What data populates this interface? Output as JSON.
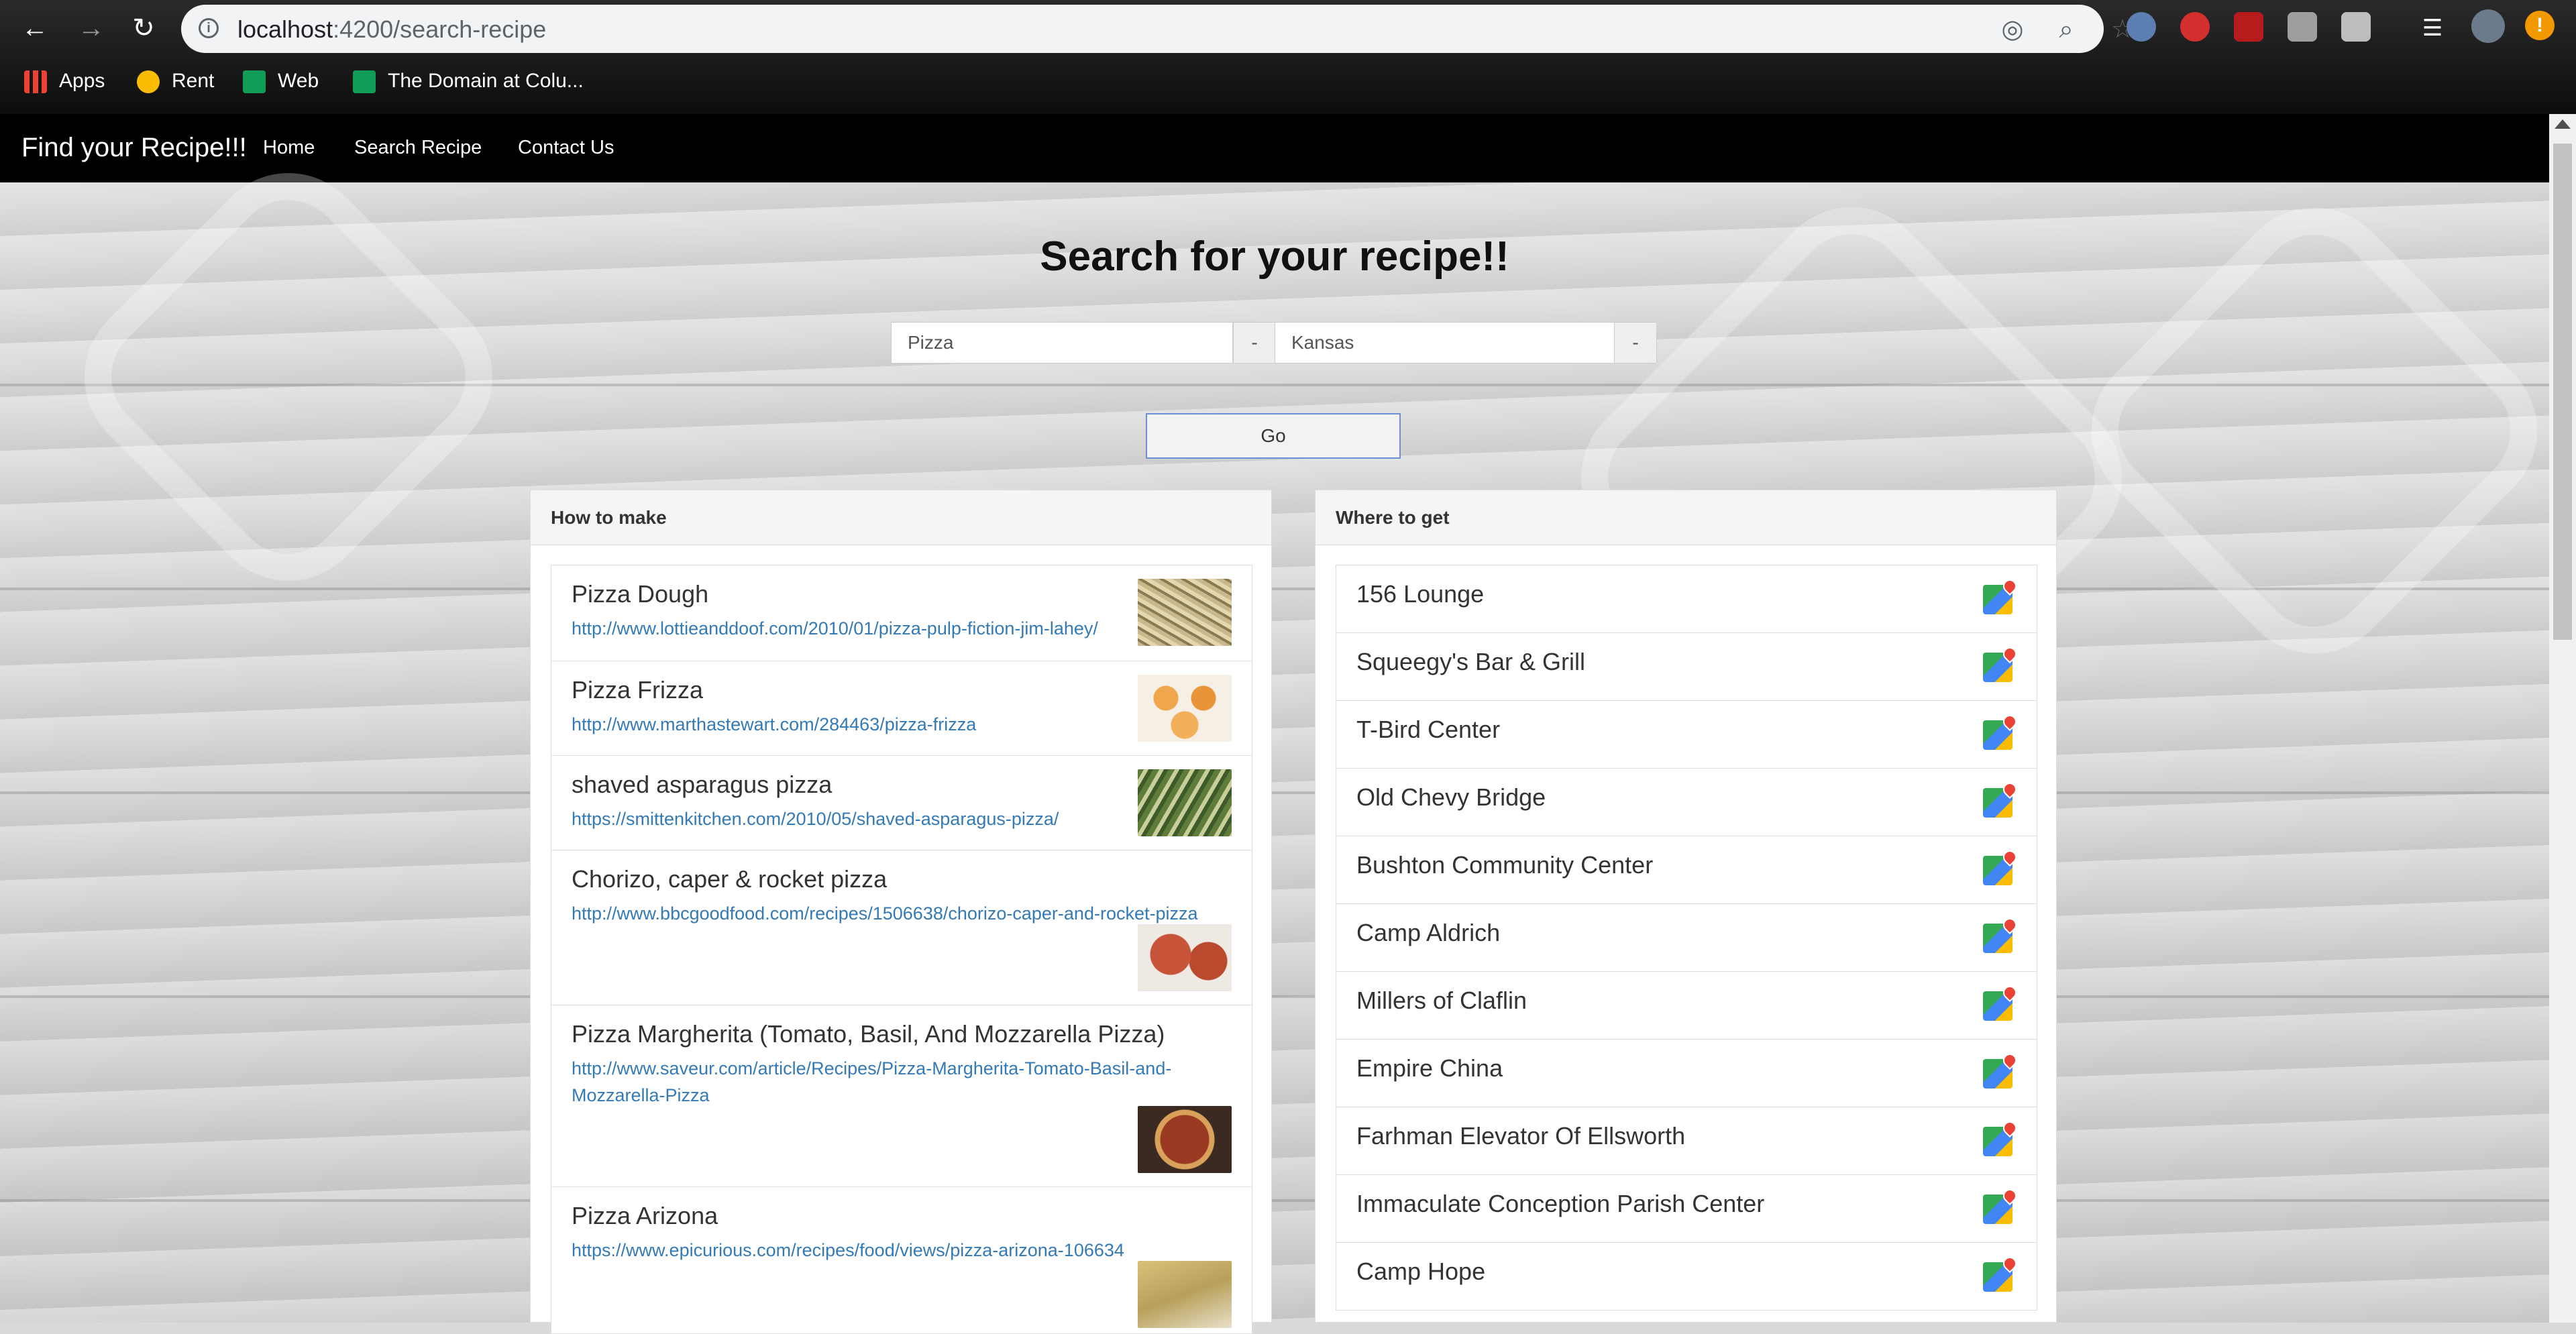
{
  "browser": {
    "url_host": "localhost",
    "url_path": ":4200/search-recipe",
    "bookmarks": [
      {
        "label": "Apps",
        "icon": "apps-grid-icon",
        "color": "#ea4335"
      },
      {
        "label": "Rent",
        "icon": "chrome-icon",
        "color": "#fbbc04"
      },
      {
        "label": "Web",
        "icon": "plus-square-icon",
        "color": "#0f9d58"
      },
      {
        "label": "The Domain at Colu...",
        "icon": "sheets-icon",
        "color": "#0f9d58"
      }
    ]
  },
  "nav": {
    "brand": "Find your Recipe!!!",
    "links": [
      "Home",
      "Search Recipe",
      "Contact Us"
    ]
  },
  "search": {
    "heading": "Search for your recipe!!",
    "query_value": "Pizza",
    "location_value": "Kansas",
    "addon_label": "-",
    "go_label": "Go"
  },
  "recipes": {
    "heading": "How to make",
    "items": [
      {
        "title": "Pizza Dough",
        "url": "http://www.lottieanddoof.com/2010/01/pizza-pulp-fiction-jim-lahey/",
        "thumb": "pizza-dough-photo"
      },
      {
        "title": "Pizza Frizza",
        "url": "http://www.marthastewart.com/284463/pizza-frizza",
        "thumb": "pizza-frizza-photo"
      },
      {
        "title": "shaved asparagus pizza",
        "url": "https://smittenkitchen.com/2010/05/shaved-asparagus-pizza/",
        "thumb": "asparagus-pizza-photo"
      },
      {
        "title": "Chorizo, caper & rocket pizza",
        "url": "http://www.bbcgoodfood.com/recipes/1506638/chorizo-caper-and-rocket-pizza",
        "thumb": "chorizo-pizza-photo"
      },
      {
        "title": "Pizza Margherita (Tomato, Basil, And Mozzarella Pizza)",
        "url": "http://www.saveur.com/article/Recipes/Pizza-Margherita-Tomato-Basil-and-Mozzarella-Pizza",
        "thumb": "margherita-pizza-photo"
      },
      {
        "title": "Pizza Arizona",
        "url": "https://www.epicurious.com/recipes/food/views/pizza-arizona-106634",
        "thumb": "pizza-arizona-photo"
      }
    ]
  },
  "places": {
    "heading": "Where to get",
    "items": [
      "156 Lounge",
      "Squeegy's Bar & Grill",
      "T-Bird Center",
      "Old Chevy Bridge",
      "Bushton Community Center",
      "Camp Aldrich",
      "Millers of Claflin",
      "Empire China",
      "Farhman Elevator Of Ellsworth",
      "Immaculate Conception Parish Center",
      "Camp Hope"
    ]
  }
}
